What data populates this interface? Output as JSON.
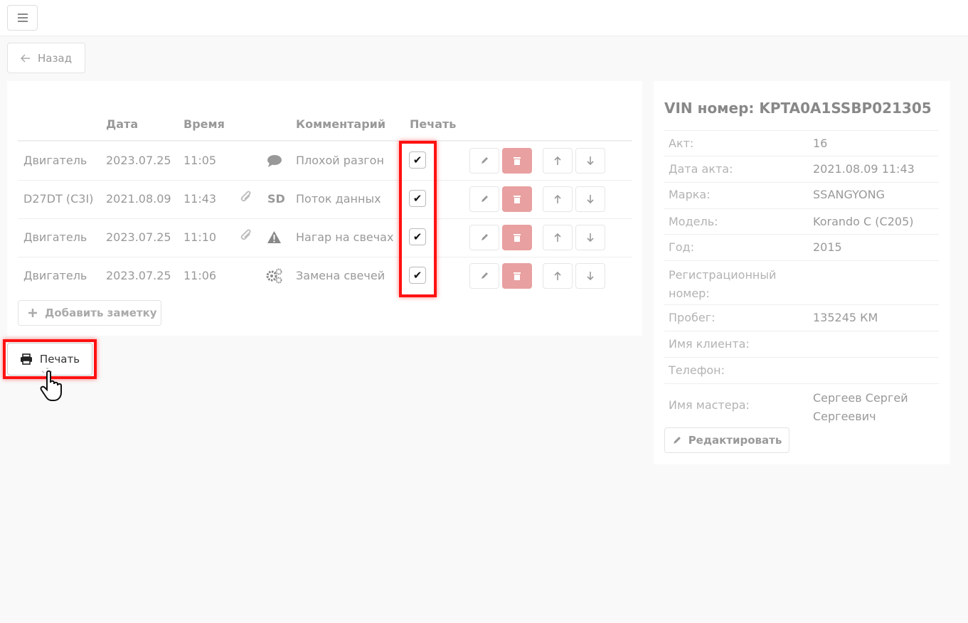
{
  "back_label": "Назад",
  "table": {
    "headers": [
      "Дата",
      "Время",
      "Комментарий",
      "Печать"
    ],
    "rows": [
      {
        "part": "Двигатель",
        "date": "2023.07.25",
        "time": "11:05",
        "comment": "Плохой разгон",
        "attachment": false,
        "type": "comment-icon",
        "printed": true
      },
      {
        "part": "D27DT (C3I)",
        "date": "2021.08.09",
        "time": "11:43",
        "comment": "Поток данных",
        "attachment": true,
        "type": "SD",
        "printed": true
      },
      {
        "part": "Двигатель",
        "date": "2023.07.25",
        "time": "11:10",
        "comment": "Нагар на свечах",
        "attachment": true,
        "type": "warning-icon",
        "printed": true
      },
      {
        "part": "Двигатель",
        "date": "2023.07.25",
        "time": "11:06",
        "comment": "Замена свечей",
        "attachment": false,
        "type": "gears-icon",
        "printed": true
      }
    ]
  },
  "add_note_label": "Добавить заметку",
  "print_label": "Печать",
  "info": {
    "title": "VIN номер: KPTA0A1SSBP021305",
    "fields": [
      {
        "label": "Акт:",
        "value": "16"
      },
      {
        "label": "Дата акта:",
        "value": "2021.08.09 11:43"
      },
      {
        "label": "Марка:",
        "value": "SSANGYONG"
      },
      {
        "label": "Модель:",
        "value": "Korando C (C205)"
      },
      {
        "label": "Год:",
        "value": "2015"
      },
      {
        "label": "Регистрационный номер:",
        "value": ""
      },
      {
        "label": "Пробег:",
        "value": "135245 КМ"
      },
      {
        "label": "Имя клиента:",
        "value": ""
      },
      {
        "label": "Телефон:",
        "value": ""
      },
      {
        "label": "Имя мастера:",
        "value": "Сергеев Сергей Сергеевич"
      }
    ],
    "edit_label": "Редактировать"
  },
  "colors": {
    "delete": "#e8a0a0",
    "highlight": "#ff1111"
  }
}
